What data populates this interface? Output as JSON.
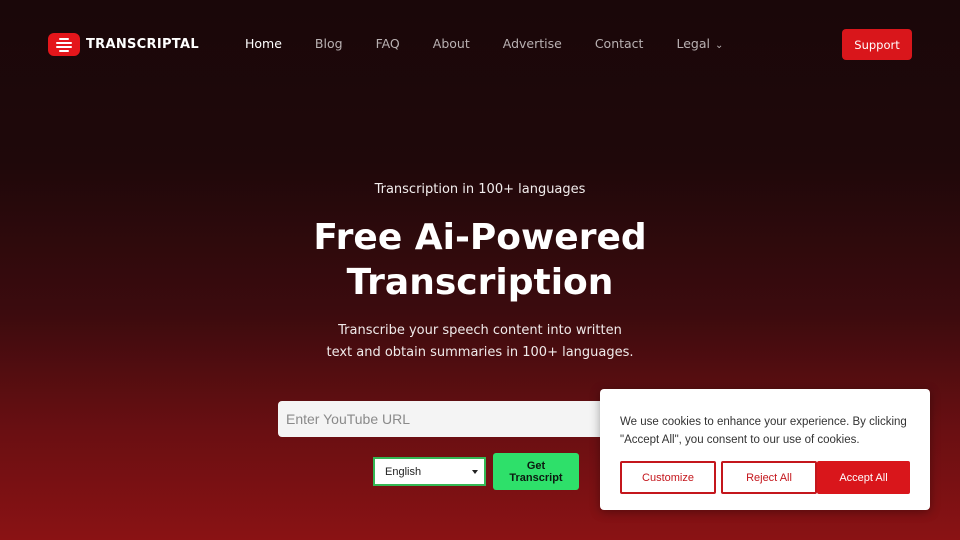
{
  "header": {
    "brand": "TRANSCRIPTAL",
    "nav": [
      {
        "label": "Home"
      },
      {
        "label": "Blog"
      },
      {
        "label": "FAQ"
      },
      {
        "label": "About"
      },
      {
        "label": "Advertise"
      },
      {
        "label": "Contact"
      },
      {
        "label": "Legal"
      }
    ],
    "support_label": "Support"
  },
  "hero": {
    "eyebrow": "Transcription in 100+ languages",
    "title_line1": "Free Ai-Powered",
    "title_line2": "Transcription",
    "subtitle_line1": "Transcribe your speech content into written",
    "subtitle_line2": "text and obtain summaries in 100+ languages."
  },
  "form": {
    "url_placeholder": "Enter YouTube URL",
    "url_value": "",
    "language_selected": "English",
    "submit_label": "Get Transcript"
  },
  "cookie": {
    "text": "We use cookies to enhance your experience. By clicking \"Accept All\", you consent to our use of cookies.",
    "customize_label": "Customize",
    "reject_label": "Reject All",
    "accept_label": "Accept All"
  },
  "colors": {
    "brand_red": "#d9161b",
    "action_green": "#2ee06a"
  }
}
